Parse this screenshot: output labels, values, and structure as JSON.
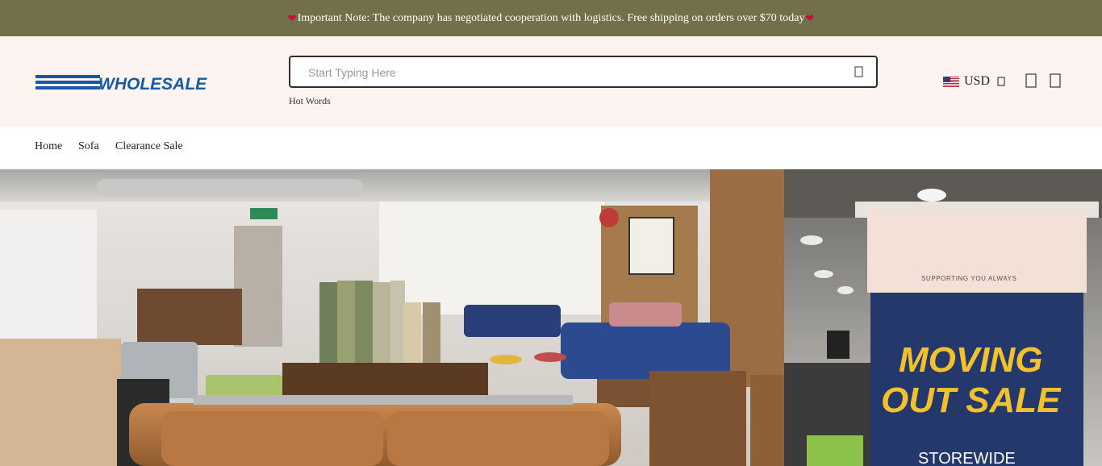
{
  "announcement": {
    "text": "Important Note: The company has negotiated cooperation with logistics. Free shipping on orders over $70 today",
    "heart_icon": "heart-icon",
    "heart_color": "#c8102e",
    "bar_color": "#726f4a"
  },
  "header": {
    "logo_text": "WHOLESALE",
    "logo_color": "#1559a8",
    "search": {
      "placeholder": "Start Typing Here",
      "value": "",
      "icon": "search-icon"
    },
    "hot_words_label": "Hot Words",
    "currency": {
      "code": "USD",
      "flag_icon": "us-flag-icon",
      "chevron_icon": "chevron-down-icon"
    },
    "icons": [
      "account-icon",
      "cart-icon"
    ]
  },
  "nav": {
    "items": [
      {
        "label": "Home"
      },
      {
        "label": "Sofa"
      },
      {
        "label": "Clearance Sale"
      }
    ]
  },
  "hero": {
    "banner": {
      "small_text": "SUPPORTING YOU ALWAYS",
      "line1": "MOVING",
      "line2": "OUT SALE",
      "line3": "STOREWIDE"
    }
  }
}
